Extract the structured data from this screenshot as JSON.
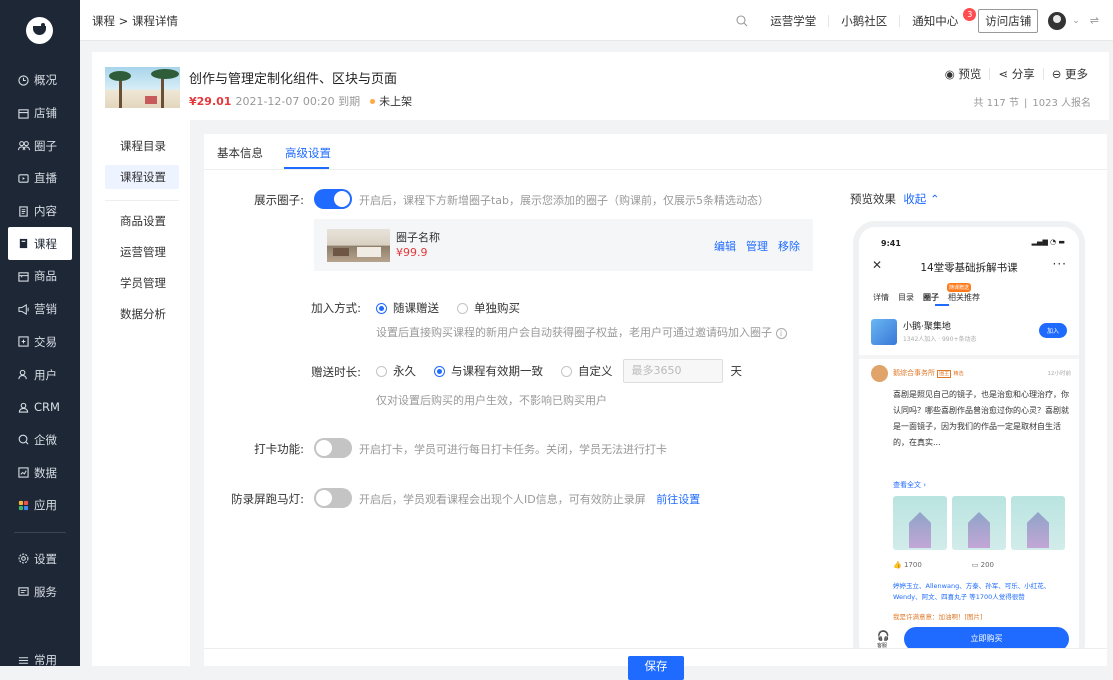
{
  "sidebar": {
    "items": [
      {
        "label": "概况",
        "icon": "clock-icon"
      },
      {
        "label": "店铺",
        "icon": "store-icon"
      },
      {
        "label": "圈子",
        "icon": "group-icon"
      },
      {
        "label": "直播",
        "icon": "live-icon"
      },
      {
        "label": "内容",
        "icon": "document-icon"
      },
      {
        "label": "课程",
        "icon": "course-icon",
        "active": true
      },
      {
        "label": "商品",
        "icon": "product-icon"
      },
      {
        "label": "营销",
        "icon": "megaphone-icon"
      },
      {
        "label": "交易",
        "icon": "trade-icon"
      },
      {
        "label": "用户",
        "icon": "user-icon"
      },
      {
        "label": "CRM",
        "icon": "crm-icon"
      },
      {
        "label": "企微",
        "icon": "wecom-icon"
      },
      {
        "label": "数据",
        "icon": "data-icon"
      },
      {
        "label": "应用",
        "icon": "apps-icon"
      }
    ],
    "bottom_items": [
      {
        "label": "设置",
        "icon": "gear-icon"
      },
      {
        "label": "服务",
        "icon": "service-icon"
      },
      {
        "label": "常用",
        "icon": "favorite-icon"
      }
    ]
  },
  "topbar": {
    "breadcrumb": "课程 > 课程详情",
    "links": [
      "运营学堂",
      "小鹅社区",
      "通知中心"
    ],
    "notification_count": "3",
    "visit_store": "访问店铺"
  },
  "header": {
    "title": "创作与管理定制化组件、区块与页面",
    "price": "¥29.01",
    "expire": "2021-12-07 00:20 到期",
    "status": "未上架",
    "actions": [
      "预览",
      "分享",
      "更多"
    ],
    "lessons": "共 117 节",
    "enrolled": "1023 人报名"
  },
  "subnav": {
    "items": [
      "课程目录",
      "课程设置",
      "商品设置",
      "运营管理",
      "学员管理",
      "数据分析"
    ],
    "active": "课程设置"
  },
  "tabs": [
    "基本信息",
    "高级设置"
  ],
  "settings": {
    "show_circle": {
      "label": "展示圈子:",
      "desc": "开启后，课程下方新增圈子tab，展示您添加的圈子（购课前，仅展示5条精选动态）",
      "enabled": true
    },
    "circle_card": {
      "name": "圈子名称",
      "price": "¥99.9",
      "actions": [
        "编辑",
        "管理",
        "移除"
      ]
    },
    "join_method": {
      "label": "加入方式:",
      "options": [
        "随课赠送",
        "单独购买"
      ],
      "selected": "随课赠送",
      "desc": "设置后直接购买课程的新用户会自动获得圈子权益，老用户可通过邀请码加入圈子"
    },
    "gift_duration": {
      "label": "赠送时长:",
      "options": [
        "永久",
        "与课程有效期一致",
        "自定义"
      ],
      "selected": "与课程有效期一致",
      "input_placeholder": "最多3650",
      "unit": "天",
      "desc": "仅对设置后购买的用户生效，不影响已购买用户"
    },
    "checkin": {
      "label": "打卡功能:",
      "desc": "开启打卡，学员可进行每日打卡任务。关闭，学员无法进行打卡",
      "enabled": false
    },
    "anti_record": {
      "label": "防录屏跑马灯:",
      "desc": "开启后，学员观看课程会出现个人ID信息，可有效防止录屏",
      "link": "前往设置",
      "enabled": false
    }
  },
  "preview": {
    "label": "预览效果",
    "collapse": "收起",
    "phone": {
      "time": "9:41",
      "title": "14堂零基础拆解书课",
      "tabs": [
        "详情",
        "目录",
        "圈子",
        "相关推荐"
      ],
      "tag": "随课赠送",
      "circle_name": "小鹅·聚集地",
      "circle_sub": "1342人加入 · 990+条动态",
      "join": "加入",
      "poster": "鹅综合事务所",
      "poster_badge1": "圈主",
      "poster_badge2": "精选",
      "post_time": "12小时前",
      "post_text": "喜剧是照见自己的镜子，也是治愈和心理治疗，你认同吗？哪些喜剧作品曾治愈过你的心灵？喜剧就是一面镜子，因为我们的作品一定是取材自生活的，在真实...",
      "read_more": "查看全文 ›",
      "likes": "1700",
      "comments": "200",
      "likers": "婷婷玉立、Allenwang、方泰、孙军、可乐、小红花、Wendy、阿文、四喜丸子 等1700人觉得很赞",
      "comment": "我是许满意意：加油啊！[图片]",
      "service": "客服",
      "buy": "立即购买"
    }
  },
  "save": "保存",
  "colors": {
    "primary": "#1f6bff",
    "sidebar": "#1e2735",
    "price": "#e4393c",
    "status_dot": "#ffa940"
  }
}
